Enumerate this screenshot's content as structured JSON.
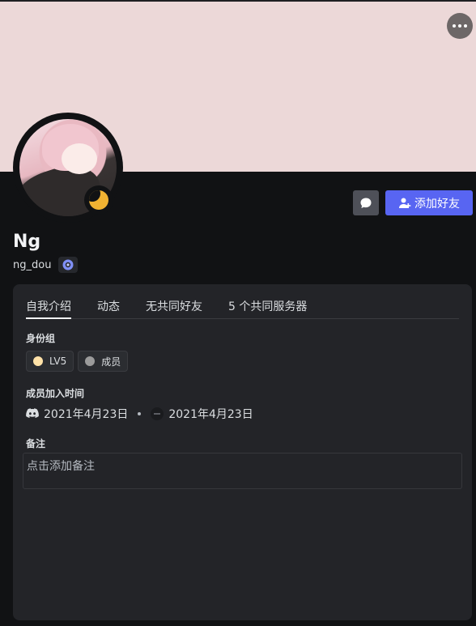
{
  "profile": {
    "display_name": "Ng",
    "username": "ng_dou",
    "status": "idle"
  },
  "actions": {
    "add_friend_label": "添加好友"
  },
  "tabs": [
    {
      "label": "自我介绍",
      "active": true
    },
    {
      "label": "动态",
      "active": false
    },
    {
      "label": "无共同好友",
      "active": false
    },
    {
      "label": "5 个共同服务器",
      "active": false
    }
  ],
  "roles": {
    "title": "身份组",
    "items": [
      {
        "label": "LV5",
        "color": "#ffe2a8"
      },
      {
        "label": "成员",
        "color": "#9b9b9b"
      }
    ]
  },
  "member_since": {
    "title": "成员加入时间",
    "discord_date": "2021年4月23日",
    "server_date": "2021年4月23日"
  },
  "note": {
    "title": "备注",
    "placeholder": "点击添加备注"
  },
  "colors": {
    "banner": "#ecd8d8",
    "accent": "#5865f2",
    "idle": "#f0b232"
  }
}
